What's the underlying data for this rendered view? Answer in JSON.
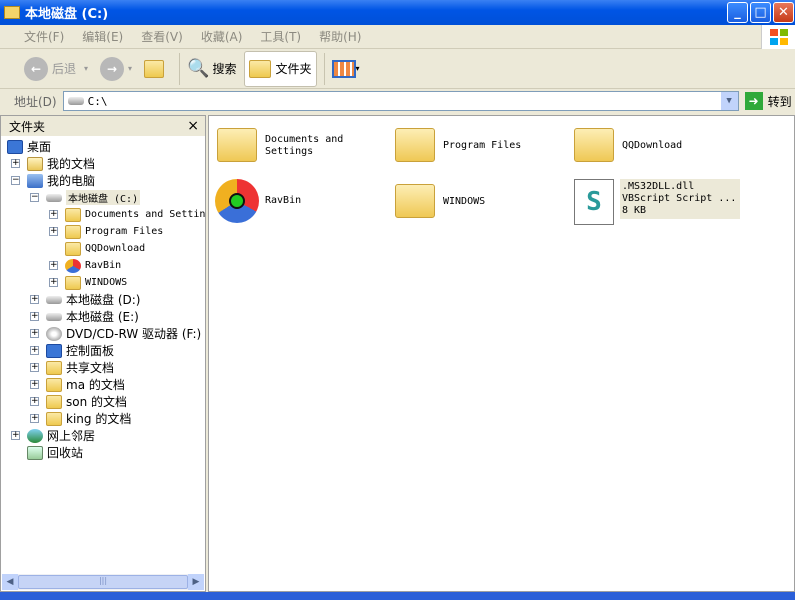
{
  "window": {
    "title": "本地磁盘 (C:)",
    "min": "_",
    "max": "□",
    "close": "✕"
  },
  "menu": [
    "文件(F)",
    "编辑(E)",
    "查看(V)",
    "收藏(A)",
    "工具(T)",
    "帮助(H)"
  ],
  "toolbar": {
    "back": "后退",
    "search": "搜索",
    "folders": "文件夹"
  },
  "address": {
    "label": "地址(D)",
    "value": "C:\\",
    "go": "转到"
  },
  "left": {
    "title": "文件夹",
    "close": "×",
    "tree": [
      "桌面",
      "我的文档",
      "我的电脑",
      "本地磁盘 (C:)",
      "Documents and Settings",
      "Program Files",
      "QQDownload",
      "RavBin",
      "WINDOWS",
      "本地磁盘 (D:)",
      "本地磁盘 (E:)",
      "DVD/CD-RW 驱动器 (F:)",
      "控制面板",
      "共享文档",
      "ma 的文档",
      "son 的文档",
      "king 的文档",
      "网上邻居",
      "回收站"
    ]
  },
  "items": [
    {
      "name": "Documents and Settings"
    },
    {
      "name": "Program Files"
    },
    {
      "name": "QQDownload"
    },
    {
      "name": "RavBin"
    },
    {
      "name": "WINDOWS"
    },
    {
      "name": ".MS32DLL.dll",
      "type": "VBScript Script ...",
      "size": "8 KB"
    }
  ]
}
